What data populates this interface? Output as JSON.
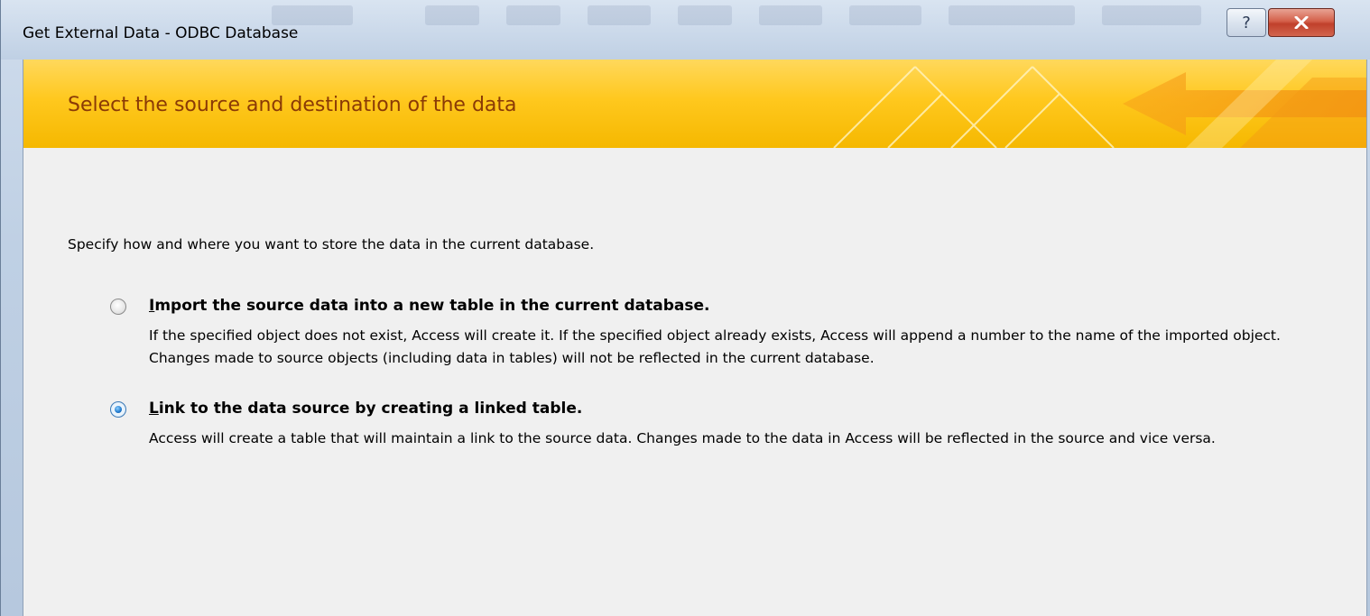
{
  "window": {
    "title": "Get External Data - ODBC Database",
    "help_glyph": "?",
    "close_icon": "close-x-icon"
  },
  "banner": {
    "title": "Select the source and destination of the data",
    "accent_color": "#ffc81e",
    "title_color": "#8a3a06"
  },
  "intro": "Specify how and where you want to store the data in the current database.",
  "options": [
    {
      "accel": "I",
      "label_rest": "mport the source data into a new table in the current database.",
      "description": "If the specified object does not exist, Access will create it. If the specified object already exists, Access will append a number to the name of the imported object. Changes made to source objects (including data in tables) will not be reflected in the current database.",
      "selected": false
    },
    {
      "accel": "L",
      "label_rest": "ink to the data source by creating a linked table.",
      "description": "Access will create a table that will maintain a link to the source data. Changes made to the data in Access will be reflected in the source and vice versa.",
      "selected": true
    }
  ]
}
